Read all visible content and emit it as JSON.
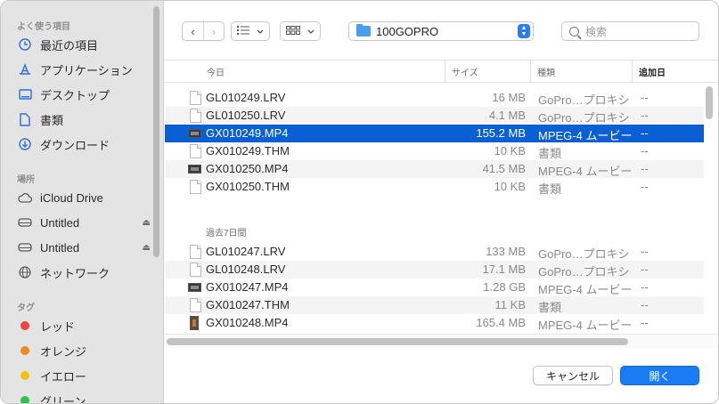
{
  "sidebar": {
    "favorites_header": "よく使う項目",
    "favorites": [
      {
        "label": "最近の項目",
        "icon": "clock-icon"
      },
      {
        "label": "アプリケーション",
        "icon": "applications-icon"
      },
      {
        "label": "デスクトップ",
        "icon": "desktop-icon"
      },
      {
        "label": "書類",
        "icon": "document-icon"
      },
      {
        "label": "ダウンロード",
        "icon": "download-icon"
      }
    ],
    "locations_header": "場所",
    "locations": [
      {
        "label": "iCloud Drive",
        "icon": "cloud-icon"
      },
      {
        "label": "Untitled",
        "icon": "drive-icon",
        "eject": "⏏"
      },
      {
        "label": "Untitled",
        "icon": "drive-icon",
        "eject": "⏏"
      },
      {
        "label": "ネットワーク",
        "icon": "network-icon"
      }
    ],
    "tags_header": "タグ",
    "tags": [
      {
        "label": "レッド",
        "color": "#f0443a"
      },
      {
        "label": "オレンジ",
        "color": "#f08a1c"
      },
      {
        "label": "イエロー",
        "color": "#f4c20d"
      },
      {
        "label": "グリーン",
        "color": "#34c04a"
      }
    ]
  },
  "toolbar": {
    "back": "‹",
    "forward": "›",
    "list_view_icon": "list-icon",
    "grid_view_icon": "grid-icon",
    "folder": "100GOPRO",
    "search_placeholder": "検索"
  },
  "table": {
    "columns": {
      "name": "今日",
      "size": "サイズ",
      "kind": "種類",
      "added": "追加日"
    },
    "groups": [
      {
        "label": "",
        "rows": [
          {
            "name": "GL010249.LRV",
            "size": "16 MB",
            "kind": "GoPro…プロキシ",
            "added": "--",
            "type": "doc"
          },
          {
            "name": "GL010250.LRV",
            "size": "4.1 MB",
            "kind": "GoPro…プロキシ",
            "added": "--",
            "type": "doc"
          },
          {
            "name": "GX010249.MP4",
            "size": "155.2 MB",
            "kind": "MPEG-4 ムービー",
            "added": "--",
            "type": "video",
            "selected": true
          },
          {
            "name": "GX010249.THM",
            "size": "10 KB",
            "kind": "書類",
            "added": "--",
            "type": "doc"
          },
          {
            "name": "GX010250.MP4",
            "size": "41.5 MB",
            "kind": "MPEG-4 ムービー",
            "added": "--",
            "type": "video"
          },
          {
            "name": "GX010250.THM",
            "size": "10 KB",
            "kind": "書類",
            "added": "--",
            "type": "doc"
          }
        ]
      },
      {
        "label": "過去7日間",
        "rows": [
          {
            "name": "GL010247.LRV",
            "size": "133 MB",
            "kind": "GoPro…プロキシ",
            "added": "--",
            "type": "doc"
          },
          {
            "name": "GL010248.LRV",
            "size": "17.1 MB",
            "kind": "GoPro…プロキシ",
            "added": "--",
            "type": "doc"
          },
          {
            "name": "GX010247.MP4",
            "size": "1.28 GB",
            "kind": "MPEG-4 ムービー",
            "added": "--",
            "type": "video"
          },
          {
            "name": "GX010247.THM",
            "size": "11 KB",
            "kind": "書類",
            "added": "--",
            "type": "doc"
          },
          {
            "name": "GX010248.MP4",
            "size": "165.4 MB",
            "kind": "MPEG-4 ムービー",
            "added": "--",
            "type": "video-tall"
          }
        ]
      }
    ]
  },
  "buttons": {
    "cancel": "キャンセル",
    "open": "開く"
  },
  "colors": {
    "accent": "#0a5fd4",
    "primary_button": "#1a7cf5"
  }
}
